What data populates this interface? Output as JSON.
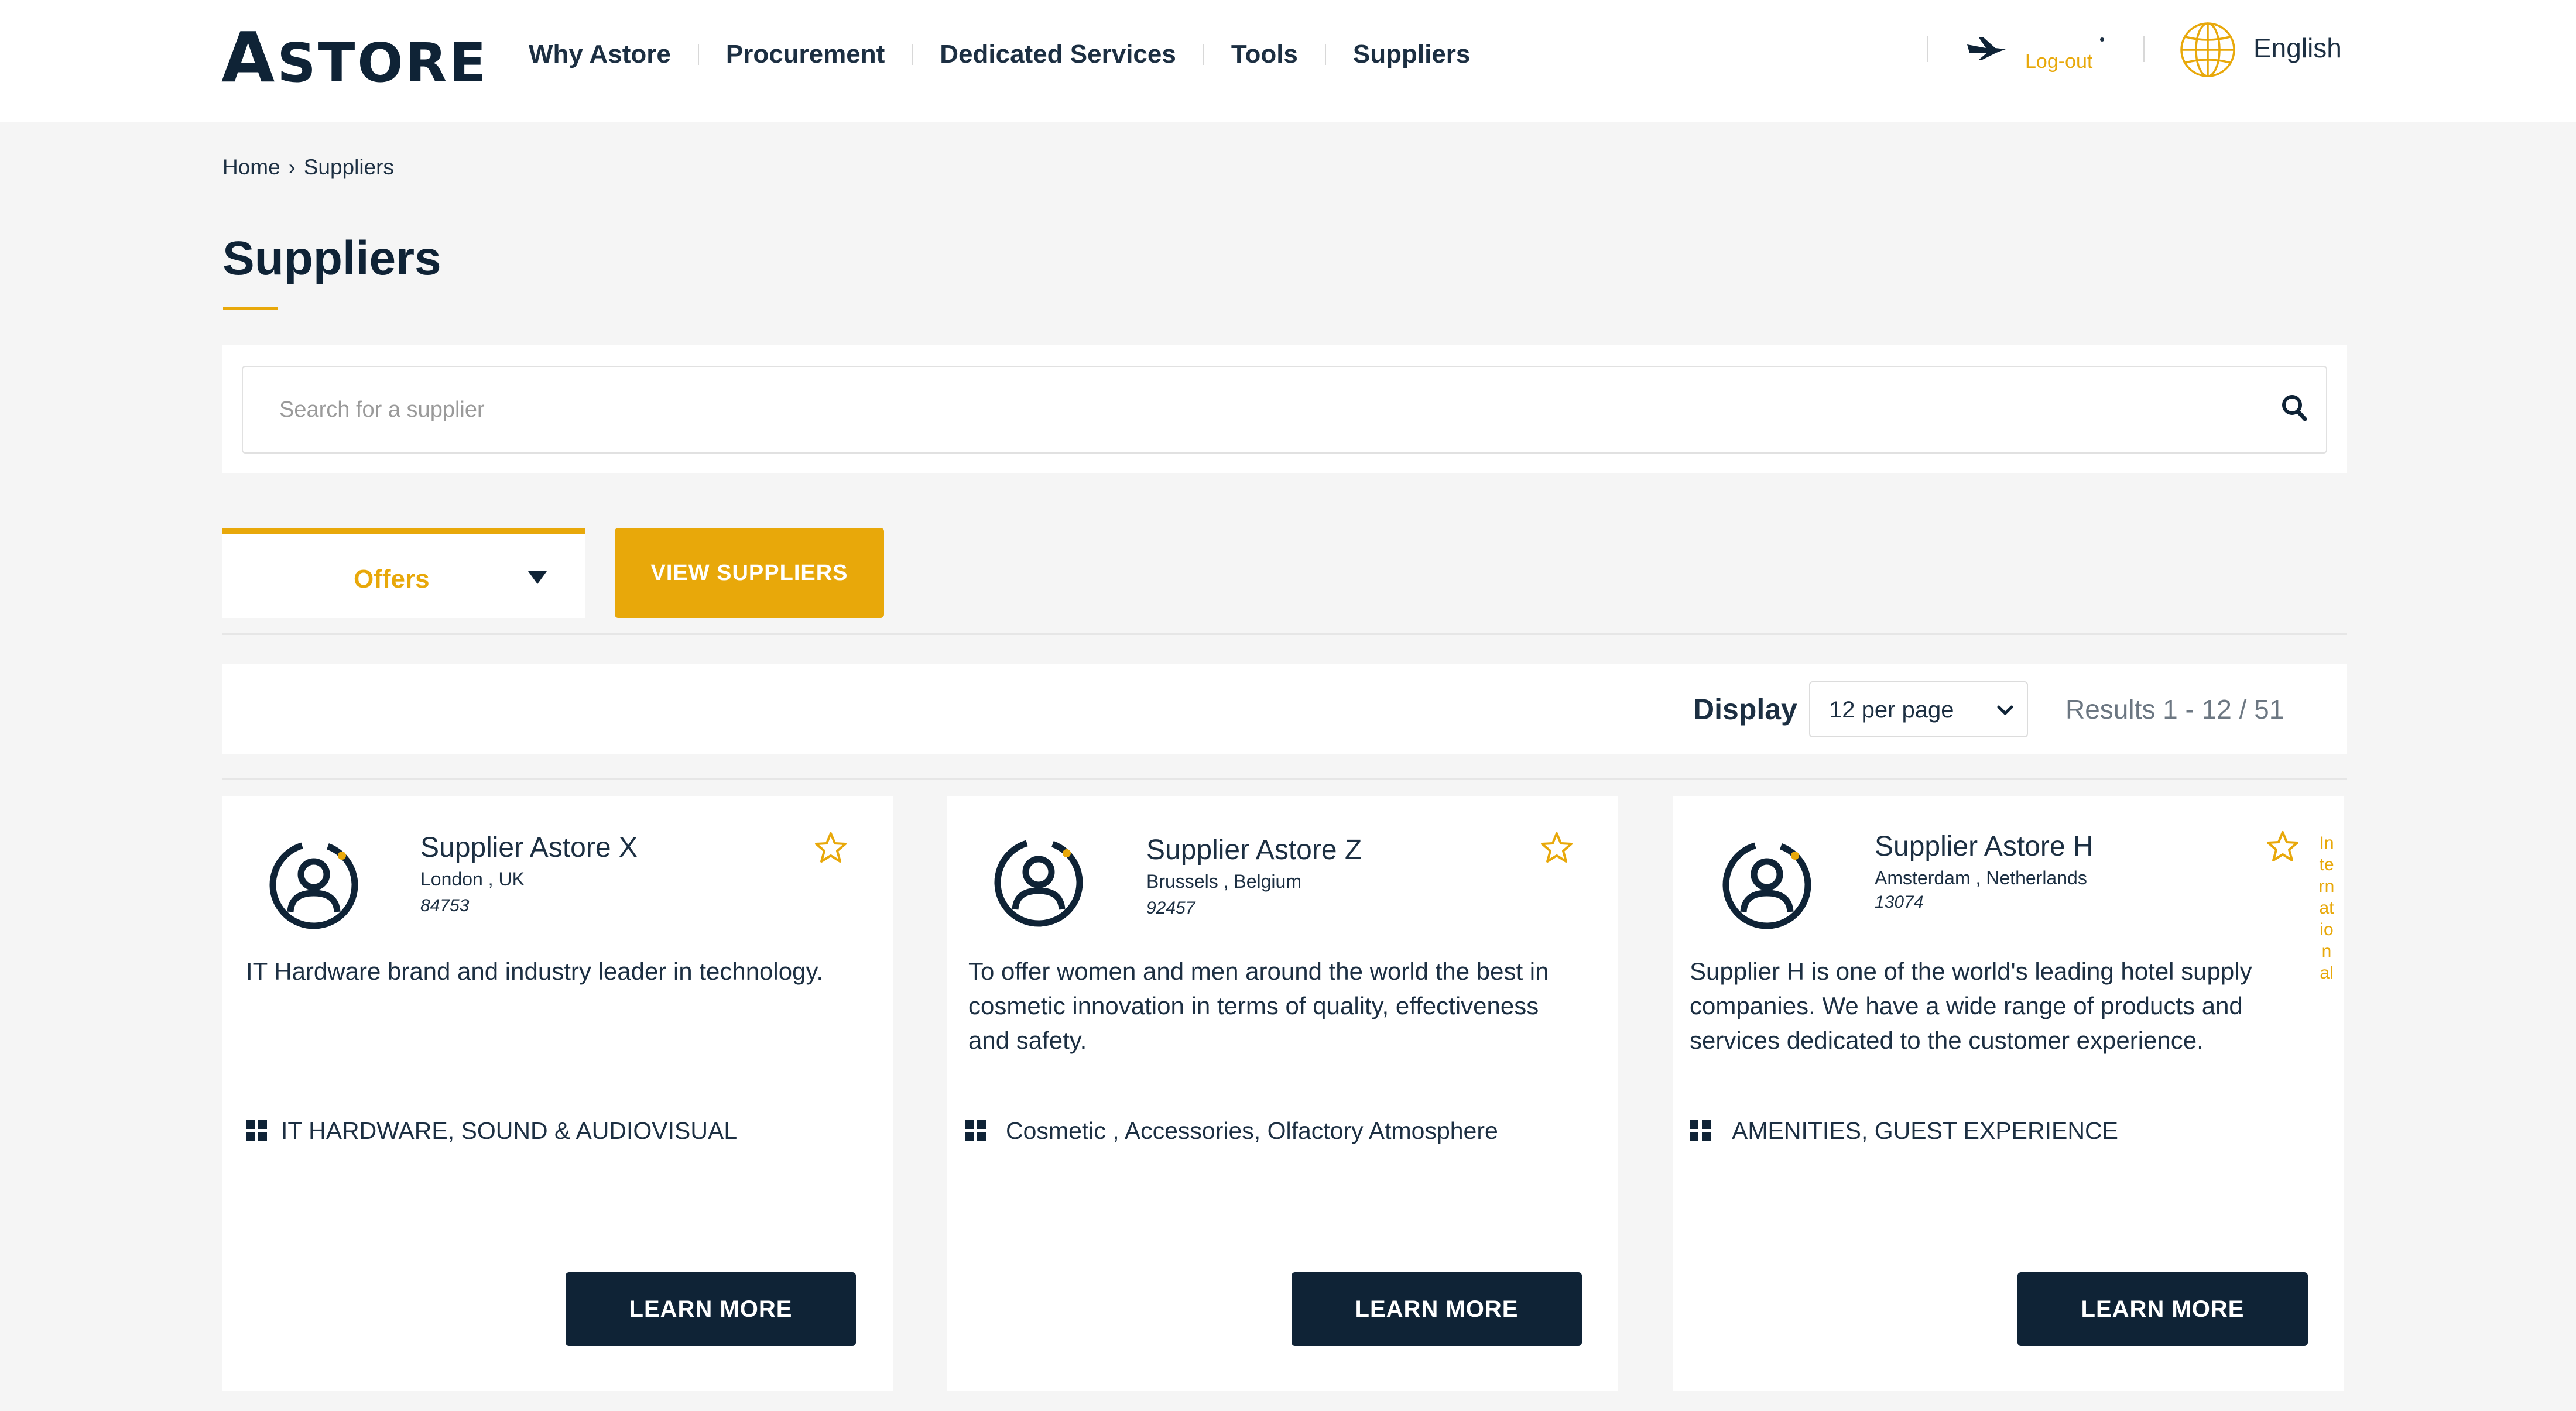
{
  "header": {
    "logo_first": "A",
    "logo_rest": "STORE",
    "nav": [
      {
        "label": "Why Astore"
      },
      {
        "label": "Procurement"
      },
      {
        "label": "Dedicated Services"
      },
      {
        "label": "Tools"
      },
      {
        "label": "Suppliers"
      }
    ],
    "logout_label": "Log-out",
    "language": "English"
  },
  "breadcrumb": {
    "items": [
      "Home",
      "Suppliers"
    ],
    "separator": "›"
  },
  "page_title": "Suppliers",
  "search": {
    "placeholder": "Search for a supplier",
    "value": ""
  },
  "filter": {
    "dropdown_label": "Offers",
    "view_button": "VIEW SUPPLIERS"
  },
  "display": {
    "label": "Display",
    "per_page": "12 per page",
    "results": "Results 1 - 12 / 51"
  },
  "cards": [
    {
      "name": "Supplier Astore X",
      "location": "London , UK",
      "code": "84753",
      "description": "IT Hardware brand and industry leader in technology.",
      "categories": "IT HARDWARE, SOUND & AUDIOVISUAL",
      "button": "LEARN MORE",
      "tag": ""
    },
    {
      "name": "Supplier Astore Z",
      "location": "Brussels , Belgium",
      "code": "92457",
      "description": "To offer women and men around the world the best in cosmetic innovation in terms of quality, effectiveness and safety.",
      "categories": "Cosmetic , Accessories, Olfactory Atmosphere",
      "button": "LEARN MORE",
      "tag": ""
    },
    {
      "name": "Supplier Astore H",
      "location": "Amsterdam , Netherlands",
      "code": "13074",
      "description": "Supplier H is one of the world's leading hotel supply companies. We have a wide range of products and services dedicated to the customer experience.",
      "categories": "AMENITIES, GUEST EXPERIENCE",
      "button": "LEARN MORE",
      "tag": "International"
    }
  ],
  "colors": {
    "accent": "#e8a80a",
    "navy": "#0f2336",
    "background": "#f5f5f5"
  }
}
